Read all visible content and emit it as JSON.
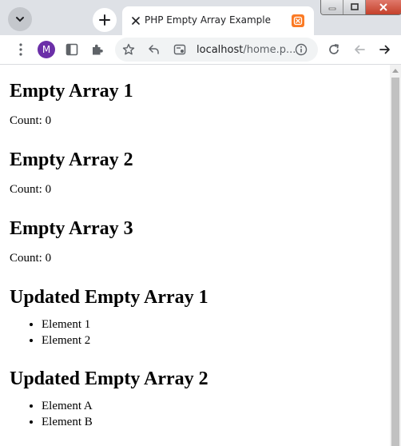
{
  "browser": {
    "tab": {
      "title": "PHP Empty Array Example",
      "favicon_icon": "xampp-icon",
      "favicon_color": "#fb7a24"
    },
    "toolbar": {
      "profile_initial": "M",
      "profile_color": "#6b2fa8",
      "url_host": "localhost",
      "url_path": "/home.p..."
    },
    "colors": {
      "tabstrip": "#dee1e6",
      "omnibox": "#f1f3f4"
    }
  },
  "page": {
    "sections": [
      {
        "heading": "Empty Array 1",
        "count": "Count: 0"
      },
      {
        "heading": "Empty Array 2",
        "count": "Count: 0"
      },
      {
        "heading": "Empty Array 3",
        "count": "Count: 0"
      },
      {
        "heading": "Updated Empty Array 1",
        "items": [
          "Element 1",
          "Element 2"
        ]
      },
      {
        "heading": "Updated Empty Array 2",
        "items": [
          "Element A",
          "Element B"
        ]
      }
    ]
  }
}
